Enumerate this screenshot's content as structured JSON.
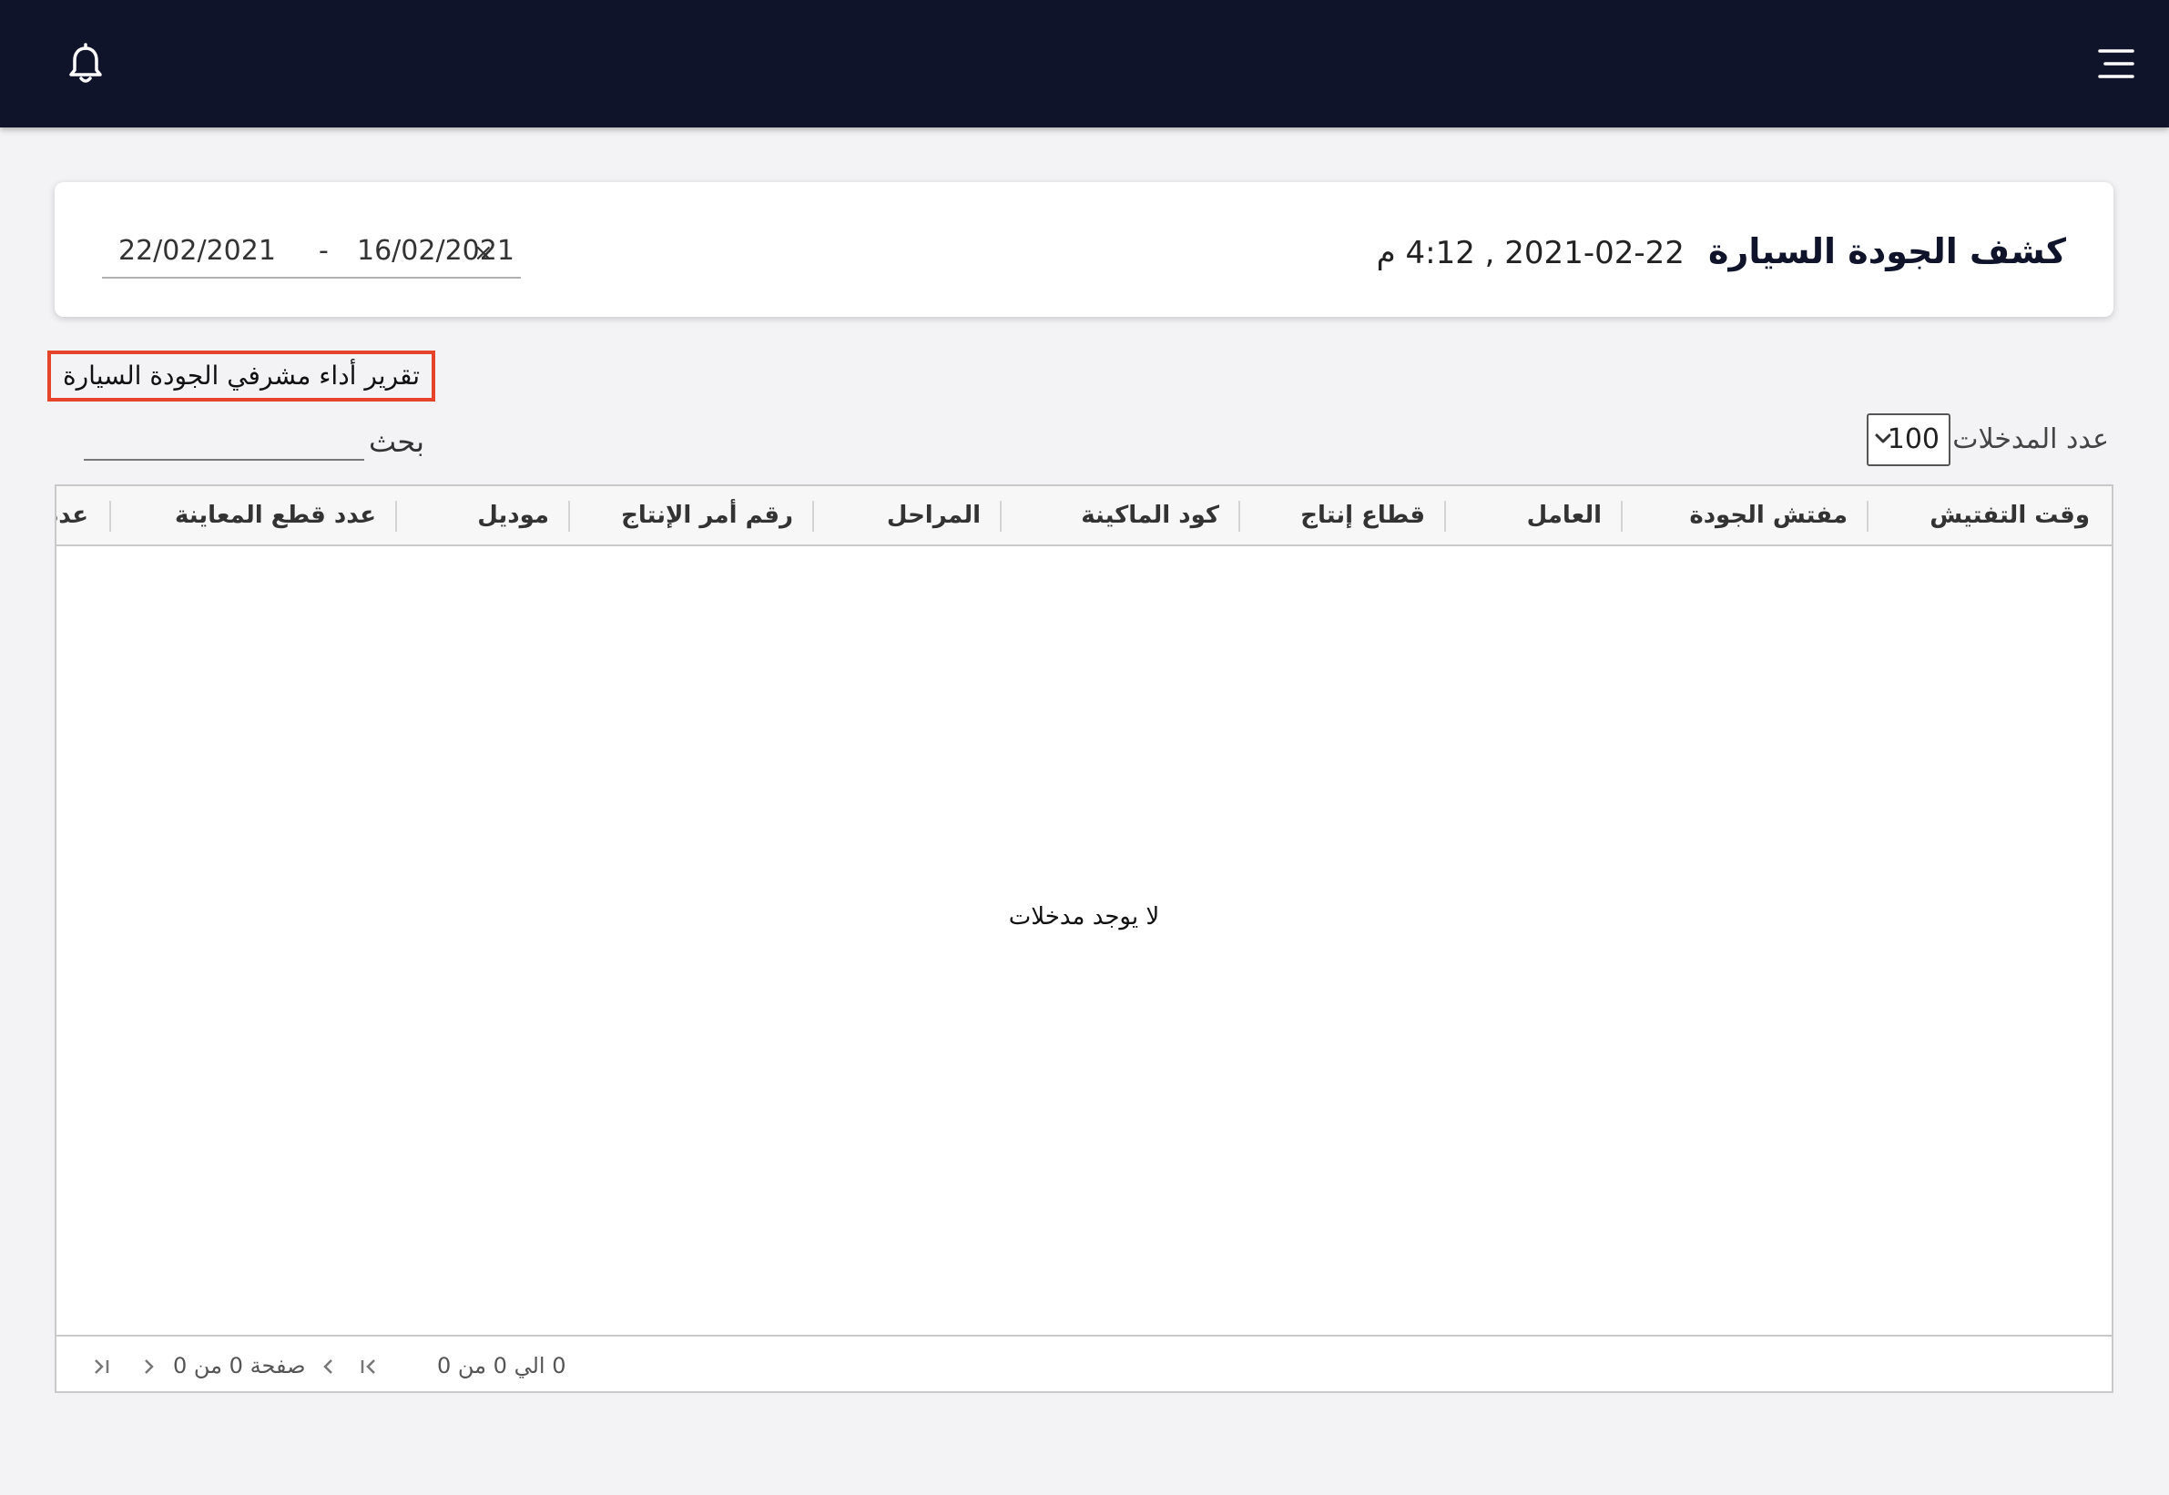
{
  "topbar": {
    "bell_icon": "bell-icon",
    "menu_icon": "hamburger-menu-icon"
  },
  "header": {
    "title": "كشف الجودة السيارة",
    "datetime": "22-02-2021 , 4:12 م",
    "date_range": {
      "start": "22/02/2021",
      "separator": "-",
      "end": "16/02/2021",
      "clear": "×"
    }
  },
  "report_title": "تقرير أداء مشرفي الجودة السيارة",
  "controls": {
    "entries_label": "عدد المدخلات",
    "entries_value": "100",
    "search_label": "بحث",
    "search_value": ""
  },
  "table": {
    "columns": [
      "وقت التفتيش",
      "مفتش الجودة",
      "العامل",
      "قطاع إنتاج",
      "كود الماكينة",
      "المراحل",
      "رقم أمر الإنتاج",
      "موديل",
      "عدد قطع المعاينة",
      "عدد"
    ],
    "rows": [],
    "empty_message": "لا يوجد مدخلات"
  },
  "pagination": {
    "range_text": "0 الي 0 من 0",
    "page_text": "صفحة 0 من 0"
  },
  "colors": {
    "topbar": "#10142a",
    "highlight_border": "#e5432a",
    "background": "#f3f3f5"
  }
}
